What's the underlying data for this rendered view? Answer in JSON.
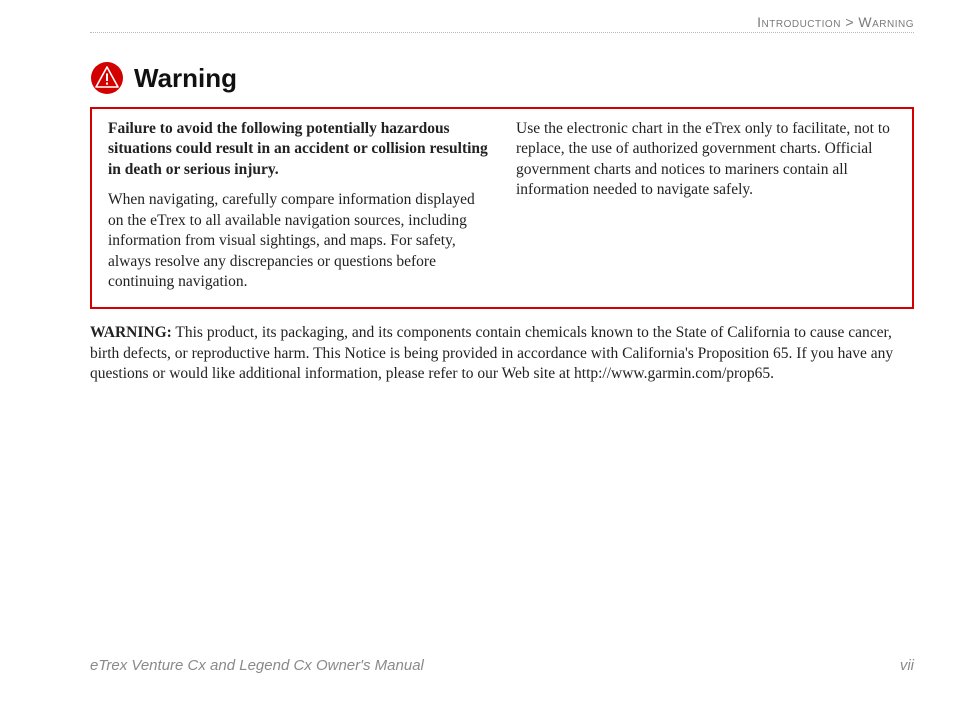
{
  "breadcrumb": {
    "section": "Introduction",
    "separator": ">",
    "page": "Warning"
  },
  "heading": "Warning",
  "icon": "warning-triangle-icon",
  "box": {
    "lead": "Failure to avoid the following potentially hazardous situations could result in an accident or collision resulting in death or serious injury.",
    "p1": "When navigating, carefully compare information displayed on the eTrex to all available navigation sources, including information from visual sightings, and maps. For safety, always resolve any discrepancies or questions before continuing navigation.",
    "p2": "Use the electronic chart in the eTrex only to facilitate, not to replace, the use of authorized government charts. Official government charts and notices to mariners contain all information needed to navigate safely."
  },
  "below": {
    "label": "WARNING:",
    "text": " This product, its packaging, and its components contain chemicals known to the State of California to cause cancer, birth defects, or reproductive harm. This Notice is being provided in accordance with California's Proposition 65. If you have any questions or would like additional information, please refer to our Web site at http://www.garmin.com/prop65."
  },
  "footer": {
    "manual": "eTrex Venture Cx and Legend Cx Owner's Manual",
    "pagenum": "vii"
  },
  "colors": {
    "accent_red": "#d30000",
    "muted_gray": "#7a7a7a"
  }
}
